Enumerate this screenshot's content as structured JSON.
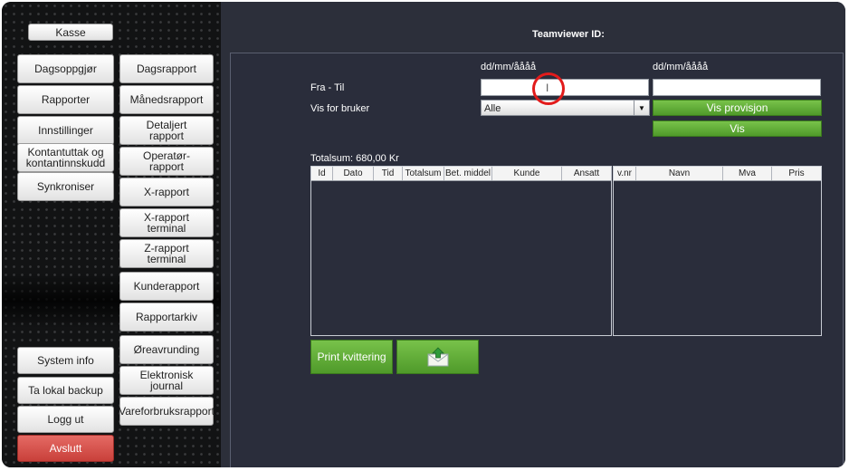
{
  "sidebar": {
    "kasse": "Kasse",
    "left_items": [
      "Dagsoppgjør",
      "Rapporter",
      "Innstillinger",
      "Kontantuttak og\nkontantinnskudd",
      "Synkroniser"
    ],
    "right_items": [
      "Dagsrapport",
      "Månedsrapport",
      "Detaljert\nrapport",
      "Operatør-\nrapport",
      "X-rapport",
      "X-rapport\nterminal",
      "Z-rapport\nterminal",
      "Kunderapport",
      "Rapportarkiv",
      "Øreavrunding",
      "Elektronisk\njournal",
      "Vareforbruksrapport"
    ],
    "bottom_items": [
      "System info",
      "Ta lokal backup",
      "Logg ut"
    ],
    "avslutt": "Avslutt"
  },
  "header": {
    "title": "Teamviewer ID:"
  },
  "form": {
    "date_format_from": "dd/mm/åååå",
    "date_format_to": "dd/mm/åååå",
    "fra_til_label": "Fra - Til",
    "vis_for_bruker_label": "Vis for bruker",
    "from_value": "",
    "to_value": "",
    "user_select_value": "Alle",
    "vis_provisjon_label": "Vis provisjon",
    "vis_label": "Vis"
  },
  "totalsum": "Totalsum: 680,00 Kr",
  "left_table": {
    "columns": [
      "Id",
      "Dato",
      "Tid",
      "Totalsum",
      "Bet. middel",
      "Kunde",
      "Ansatt"
    ],
    "rows": []
  },
  "right_table": {
    "columns": [
      "v.nr",
      "Navn",
      "Mva",
      "Pris"
    ],
    "rows": []
  },
  "actions": {
    "print_label": "Print kvittering"
  },
  "colors": {
    "accent_green": "#5fad36",
    "danger_red": "#d4504a",
    "background": "#2c2f3a"
  }
}
